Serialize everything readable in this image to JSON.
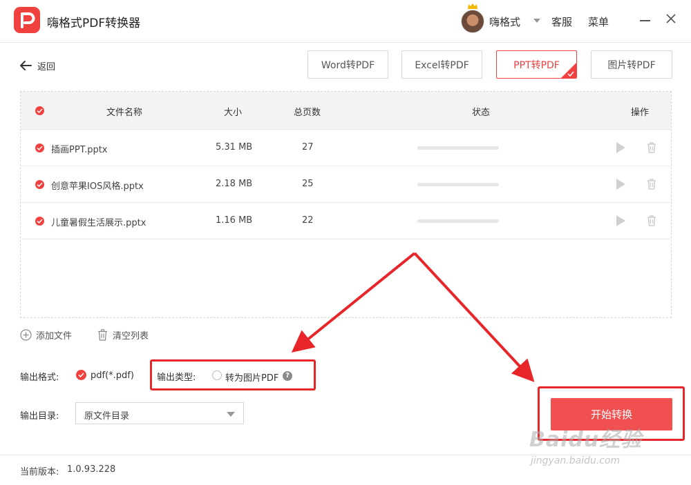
{
  "app": {
    "title": "嗨格式PDF转换器",
    "user_name": "嗨格式",
    "customer_service": "客服",
    "menu": "菜单"
  },
  "nav": {
    "back_label": "返回"
  },
  "tabs": [
    {
      "label": "Word转PDF",
      "active": false
    },
    {
      "label": "Excel转PDF",
      "active": false
    },
    {
      "label": "PPT转PDF",
      "active": true
    },
    {
      "label": "图片转PDF",
      "active": false
    }
  ],
  "table": {
    "headers": {
      "name": "文件名称",
      "size": "大小",
      "pages": "总页数",
      "status": "状态",
      "actions": "操作"
    },
    "rows": [
      {
        "name": "插画PPT.pptx",
        "size": "5.31 MB",
        "pages": "27",
        "progress": 0
      },
      {
        "name": "创意苹果IOS风格.pptx",
        "size": "2.18 MB",
        "pages": "25",
        "progress": 0
      },
      {
        "name": "儿童暑假生活展示.pptx",
        "size": "1.16 MB",
        "pages": "22",
        "progress": 0
      }
    ]
  },
  "actions": {
    "add_file": "添加文件",
    "clear_list": "清空列表"
  },
  "output": {
    "format_label": "输出格式:",
    "format_value": "pdf(*.pdf)",
    "type_label": "输出类型:",
    "type_option": "转为图片PDF",
    "help": "?",
    "dir_label": "输出目录:",
    "dir_value": "原文件目录"
  },
  "start_button": "开始转换",
  "footer": {
    "version_label": "当前版本:",
    "version_value": "1.0.93.228"
  },
  "watermark": {
    "main": "Baidu经验",
    "sub": "jingyan.baidu.com"
  },
  "colors": {
    "accent": "#f0413f",
    "annotation": "#e8262a"
  }
}
